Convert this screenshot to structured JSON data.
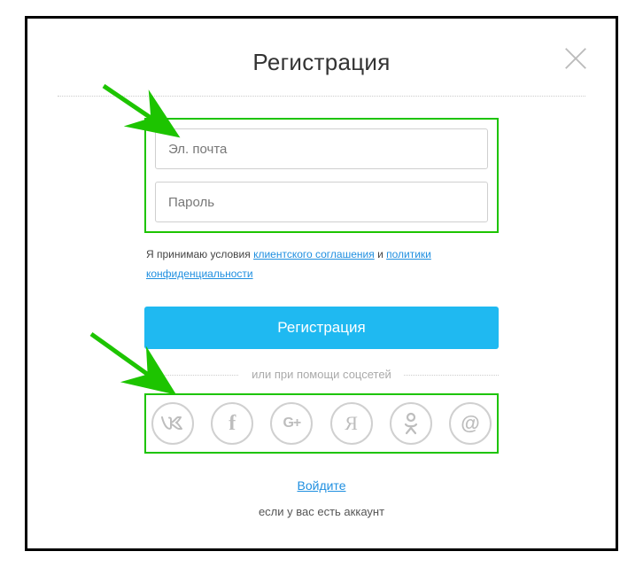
{
  "title": "Регистрация",
  "inputs": {
    "email_placeholder": "Эл. почта",
    "password_placeholder": "Пароль"
  },
  "terms": {
    "prefix": "Я принимаю условия ",
    "link1": "клиентского соглашения",
    "mid": " и ",
    "link2": "политики конфиденциальности"
  },
  "submit_label": "Регистрация",
  "divider_label": "или при помощи соцсетей",
  "social": {
    "vk": "w",
    "fb": "f",
    "gp": "G+",
    "ya": "Я",
    "ok": "ok",
    "mail": "@"
  },
  "login_link": "Войдите",
  "footer": "если у вас есть аккаунт"
}
